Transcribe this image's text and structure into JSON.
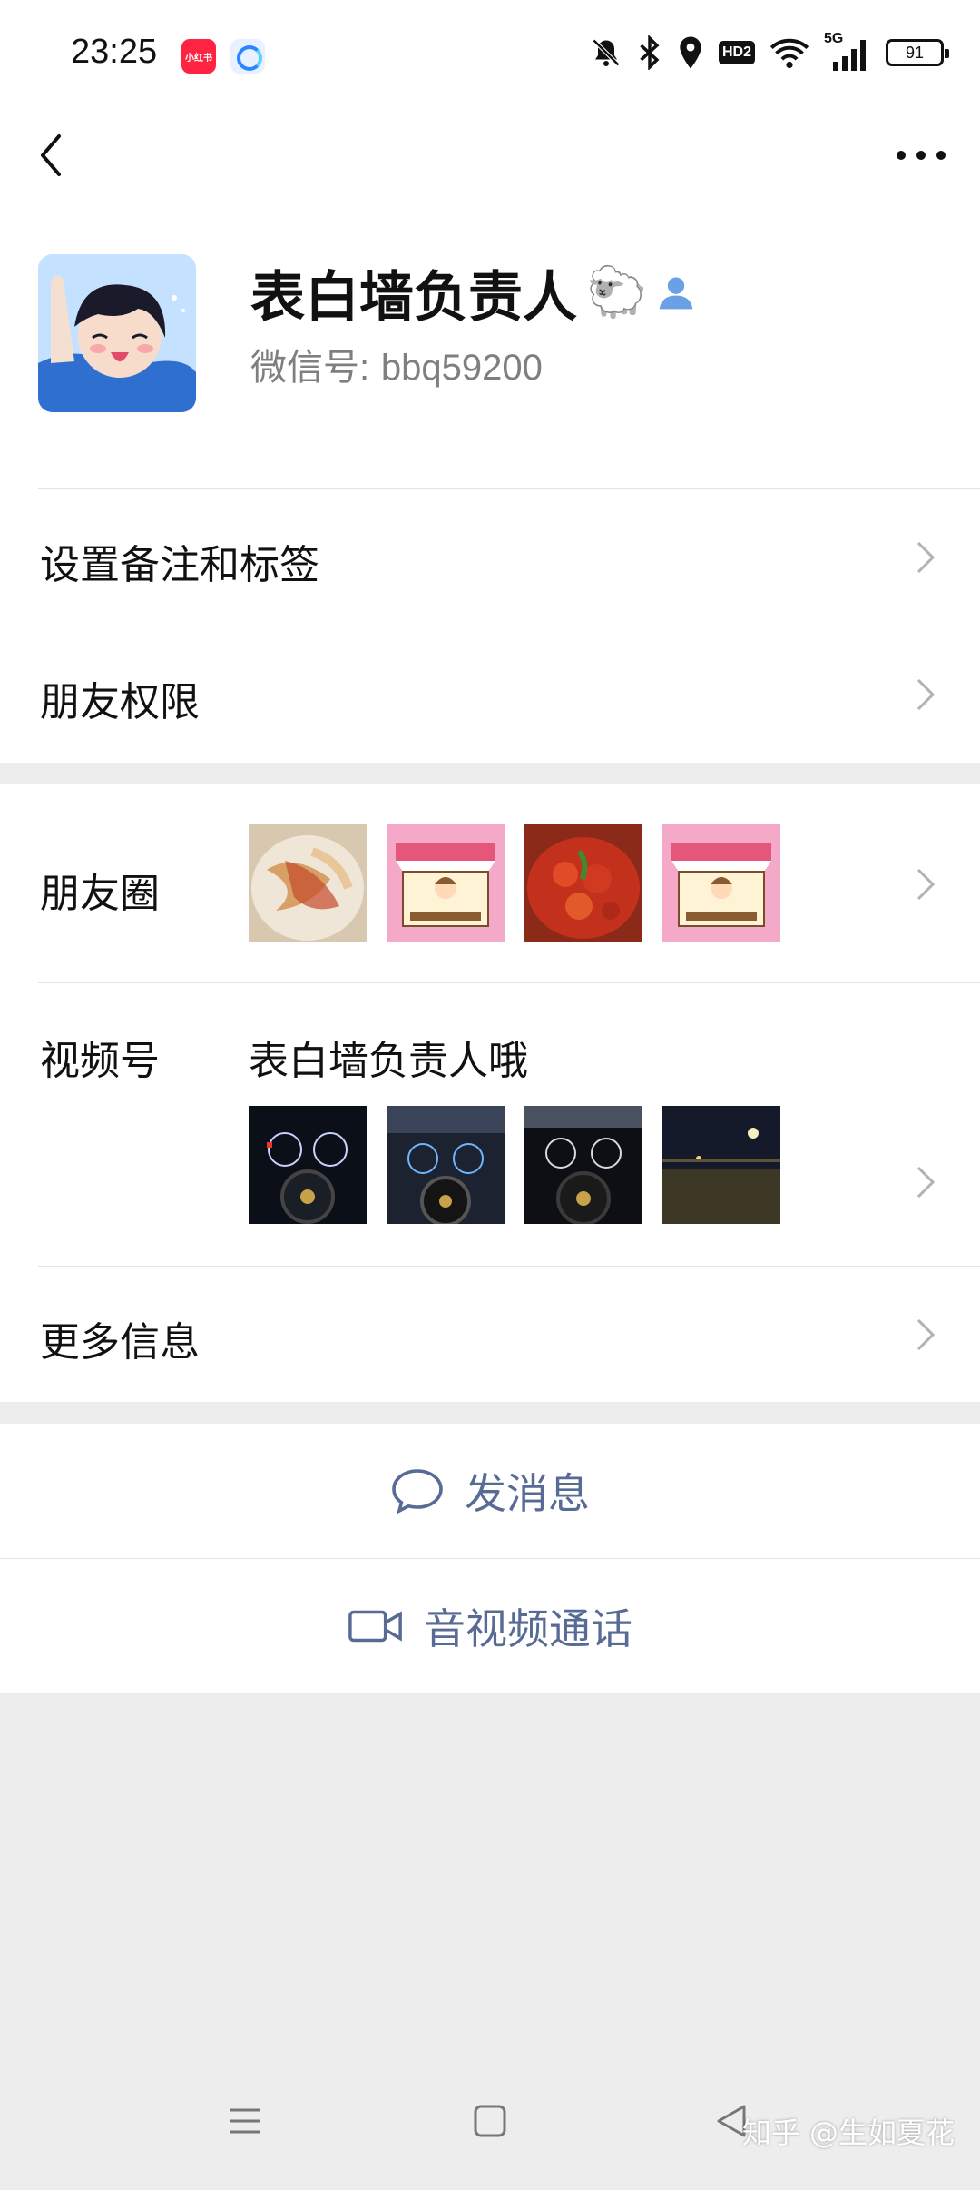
{
  "status_bar": {
    "time": "23:25",
    "app_icon_1": "小红书",
    "battery": "91",
    "network_label": "5G",
    "hd_label": "HD2"
  },
  "profile": {
    "nickname": "表白墙负责人",
    "nickname_emoji": "🐑",
    "wechat_id_label": "微信号:",
    "wechat_id": "bbq59200"
  },
  "menu": {
    "remark_tags": "设置备注和标签",
    "friend_permissions": "朋友权限",
    "moments": "朋友圈",
    "channels": "视频号",
    "channels_name": "表白墙负责人哦",
    "more_info": "更多信息"
  },
  "actions": {
    "send_message": "发消息",
    "voice_video_call": "音视频通话"
  },
  "watermark": "知乎 @生如夏花",
  "colors": {
    "link_blue": "#576b95",
    "background": "#ededed"
  },
  "icons": [
    "back-icon",
    "more-icon",
    "mute-bell-icon",
    "bluetooth-icon",
    "location-icon",
    "wifi-icon",
    "signal-icon",
    "chevron-right-icon",
    "chat-bubble-icon",
    "video-camera-icon",
    "menu-nav-icon",
    "home-nav-icon",
    "back-nav-icon"
  ]
}
